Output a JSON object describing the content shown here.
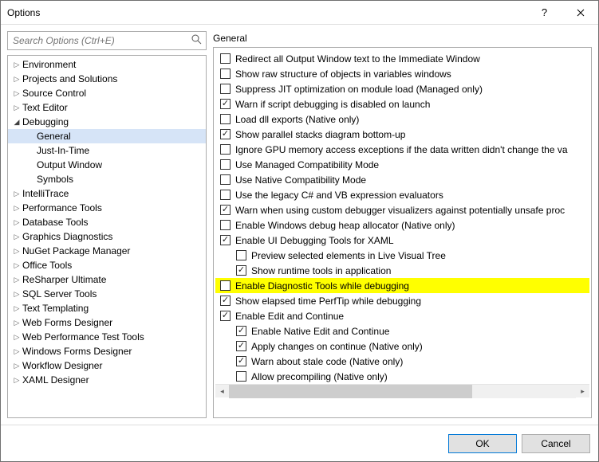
{
  "window": {
    "title": "Options"
  },
  "search": {
    "placeholder": "Search Options (Ctrl+E)"
  },
  "tree": [
    {
      "label": "Environment",
      "depth": 0,
      "arrow": "closed"
    },
    {
      "label": "Projects and Solutions",
      "depth": 0,
      "arrow": "closed"
    },
    {
      "label": "Source Control",
      "depth": 0,
      "arrow": "closed"
    },
    {
      "label": "Text Editor",
      "depth": 0,
      "arrow": "closed"
    },
    {
      "label": "Debugging",
      "depth": 0,
      "arrow": "open"
    },
    {
      "label": "General",
      "depth": 1,
      "arrow": "none",
      "selected": true
    },
    {
      "label": "Just-In-Time",
      "depth": 1,
      "arrow": "none"
    },
    {
      "label": "Output Window",
      "depth": 1,
      "arrow": "none"
    },
    {
      "label": "Symbols",
      "depth": 1,
      "arrow": "none"
    },
    {
      "label": "IntelliTrace",
      "depth": 0,
      "arrow": "closed"
    },
    {
      "label": "Performance Tools",
      "depth": 0,
      "arrow": "closed"
    },
    {
      "label": "Database Tools",
      "depth": 0,
      "arrow": "closed"
    },
    {
      "label": "Graphics Diagnostics",
      "depth": 0,
      "arrow": "closed"
    },
    {
      "label": "NuGet Package Manager",
      "depth": 0,
      "arrow": "closed"
    },
    {
      "label": "Office Tools",
      "depth": 0,
      "arrow": "closed"
    },
    {
      "label": "ReSharper Ultimate",
      "depth": 0,
      "arrow": "closed"
    },
    {
      "label": "SQL Server Tools",
      "depth": 0,
      "arrow": "closed"
    },
    {
      "label": "Text Templating",
      "depth": 0,
      "arrow": "closed"
    },
    {
      "label": "Web Forms Designer",
      "depth": 0,
      "arrow": "closed"
    },
    {
      "label": "Web Performance Test Tools",
      "depth": 0,
      "arrow": "closed"
    },
    {
      "label": "Windows Forms Designer",
      "depth": 0,
      "arrow": "closed"
    },
    {
      "label": "Workflow Designer",
      "depth": 0,
      "arrow": "closed"
    },
    {
      "label": "XAML Designer",
      "depth": 0,
      "arrow": "closed"
    }
  ],
  "section": {
    "title": "General"
  },
  "options": [
    {
      "label": "Redirect all Output Window text to the Immediate Window",
      "checked": false,
      "indent": 0
    },
    {
      "label": "Show raw structure of objects in variables windows",
      "checked": false,
      "indent": 0
    },
    {
      "label": "Suppress JIT optimization on module load (Managed only)",
      "checked": false,
      "indent": 0
    },
    {
      "label": "Warn if script debugging is disabled on launch",
      "checked": true,
      "indent": 0
    },
    {
      "label": "Load dll exports (Native only)",
      "checked": false,
      "indent": 0
    },
    {
      "label": "Show parallel stacks diagram bottom-up",
      "checked": true,
      "indent": 0
    },
    {
      "label": "Ignore GPU memory access exceptions if the data written didn't change the va",
      "checked": false,
      "indent": 0
    },
    {
      "label": "Use Managed Compatibility Mode",
      "checked": false,
      "indent": 0
    },
    {
      "label": "Use Native Compatibility Mode",
      "checked": false,
      "indent": 0
    },
    {
      "label": "Use the legacy C# and VB expression evaluators",
      "checked": false,
      "indent": 0
    },
    {
      "label": "Warn when using custom debugger visualizers against potentially unsafe proc",
      "checked": true,
      "indent": 0
    },
    {
      "label": "Enable Windows debug heap allocator (Native only)",
      "checked": false,
      "indent": 0
    },
    {
      "label": "Enable UI Debugging Tools for XAML",
      "checked": true,
      "indent": 0
    },
    {
      "label": "Preview selected elements in Live Visual Tree",
      "checked": false,
      "indent": 1
    },
    {
      "label": "Show runtime tools in application",
      "checked": true,
      "indent": 1
    },
    {
      "label": "Enable Diagnostic Tools while debugging",
      "checked": false,
      "indent": 0,
      "highlight": true
    },
    {
      "label": "Show elapsed time PerfTip while debugging",
      "checked": true,
      "indent": 0
    },
    {
      "label": "Enable Edit and Continue",
      "checked": true,
      "indent": 0
    },
    {
      "label": "Enable Native Edit and Continue",
      "checked": true,
      "indent": 1
    },
    {
      "label": "Apply changes on continue (Native only)",
      "checked": true,
      "indent": 1
    },
    {
      "label": "Warn about stale code (Native only)",
      "checked": true,
      "indent": 1
    },
    {
      "label": "Allow precompiling (Native only)",
      "checked": false,
      "indent": 1
    }
  ],
  "buttons": {
    "ok": "OK",
    "cancel": "Cancel"
  }
}
